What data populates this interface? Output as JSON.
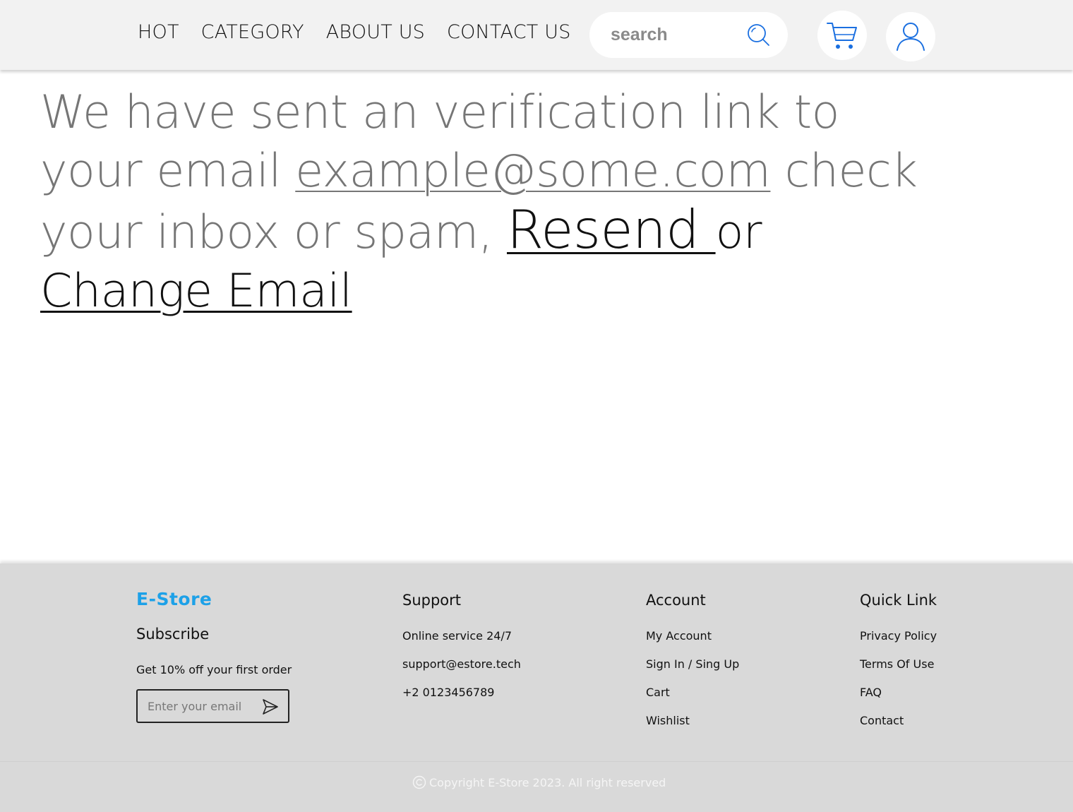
{
  "nav": {
    "items": [
      {
        "label": "HOT"
      },
      {
        "label": "CATEGORY"
      },
      {
        "label": "ABOUT US"
      },
      {
        "label": "CONTACT US"
      }
    ]
  },
  "search": {
    "placeholder": "search",
    "icon": "search-icon"
  },
  "header_icons": {
    "cart": "cart-icon",
    "user": "user-icon",
    "accent_color": "#1a6fe0"
  },
  "message": {
    "text_before": "We have sent an verification link to your email ",
    "email": "example@some.com",
    "text_middle": " check your inbox or spam, ",
    "resend": "Resend ",
    "or": "or ",
    "change_email": "Change Email"
  },
  "footer": {
    "brand": "E-Store",
    "brand_color": "#1da1e8",
    "subscribe": {
      "title": "Subscribe",
      "offer": "Get 10% off your first order",
      "placeholder": "Enter your email",
      "icon": "send-icon"
    },
    "support": {
      "title": "Support",
      "items": [
        "Online service 24/7",
        "support@estore.tech",
        "+2 0123456789"
      ]
    },
    "account": {
      "title": "Account",
      "items": [
        "My Account",
        "Sign In / Sing Up",
        "Cart",
        "Wishlist"
      ]
    },
    "quick_link": {
      "title": "Quick Link",
      "items": [
        "Privacy Policy",
        "Terms Of Use",
        "FAQ",
        "Contact"
      ]
    },
    "copyright": "Copyright E-Store 2023. All right reserved"
  }
}
